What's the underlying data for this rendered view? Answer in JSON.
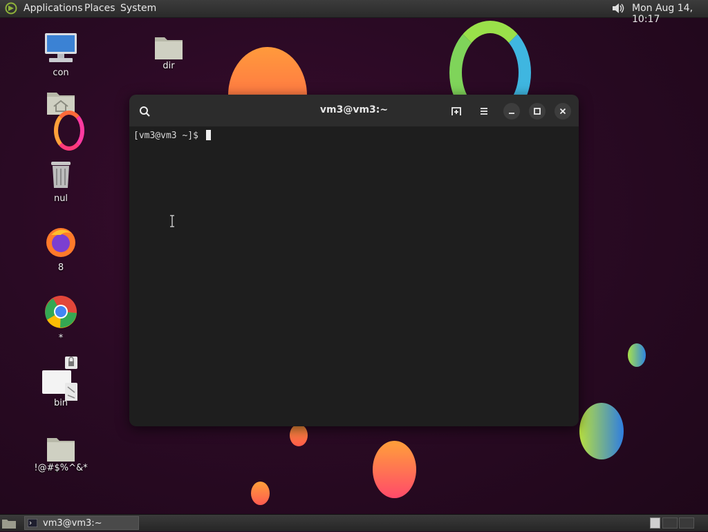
{
  "top_panel": {
    "menus": [
      "Applications",
      "Places",
      "System"
    ],
    "clock": "Mon Aug 14, 10:17",
    "icons": [
      "distro-logo-icon",
      "volume-icon"
    ]
  },
  "desktop": {
    "icons": [
      {
        "label": "con",
        "icon": "computer-icon"
      },
      {
        "label": "dir",
        "icon": "folder-icon"
      },
      {
        "label": "",
        "icon": "home-folder-icon"
      },
      {
        "label": "nul",
        "icon": "trash-icon"
      },
      {
        "label": "8",
        "icon": "firefox-icon"
      },
      {
        "label": "*",
        "icon": "chrome-icon"
      },
      {
        "label": "bin",
        "icon": "locked-file-icon"
      },
      {
        "label": "!@#$%^&*",
        "icon": "folder-icon"
      }
    ]
  },
  "terminal": {
    "title": "vm3@vm3:~",
    "prompt": "[vm3@vm3 ~]$ ",
    "buttons": [
      "search-icon",
      "new-tab-icon",
      "menu-icon",
      "minimize-icon",
      "maximize-icon",
      "close-icon"
    ]
  },
  "taskbar": {
    "window_label": "vm3@vm3:~"
  },
  "colors": {
    "desktop_bg": "#2a0a24",
    "terminal_bg": "#1e1e1e",
    "terminal_header": "#2c2c2c"
  }
}
